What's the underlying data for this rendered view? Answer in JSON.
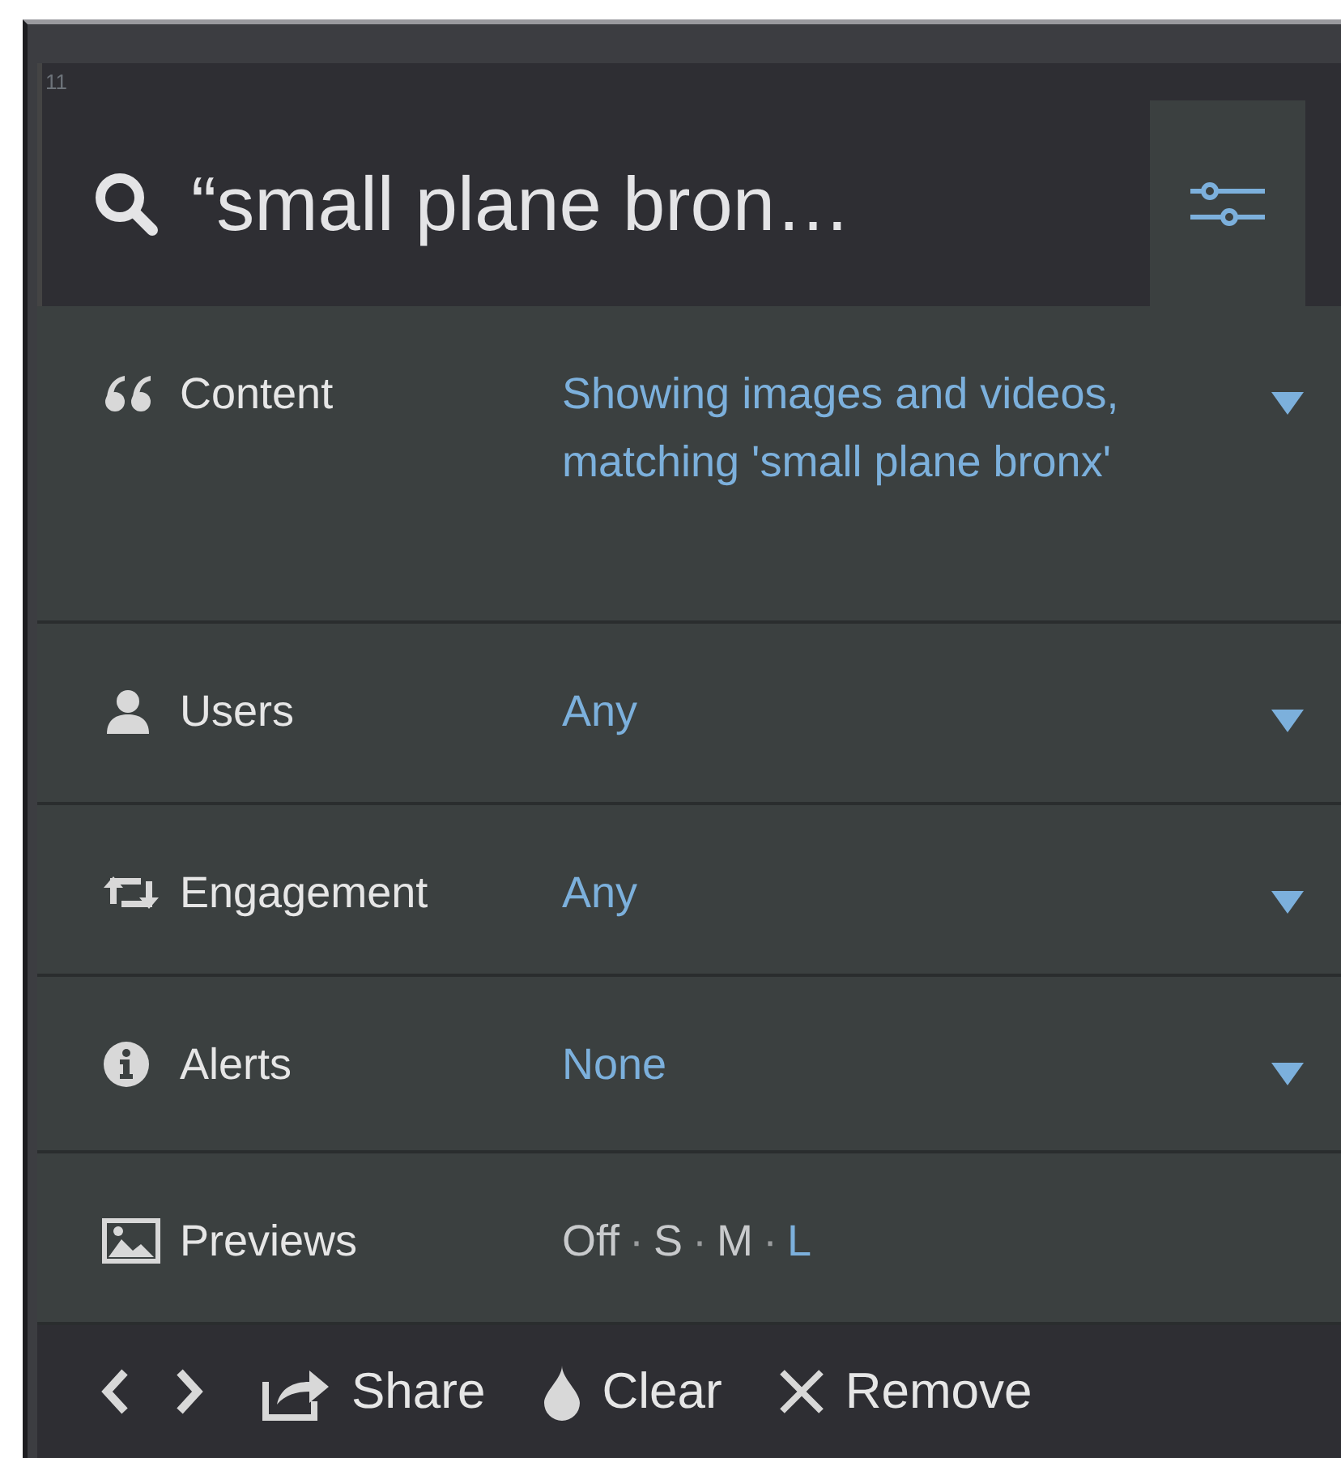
{
  "column": {
    "number": "11",
    "title": "“small plane bron…"
  },
  "filters": [
    {
      "kind": "dropdown",
      "label": "Content",
      "value": "Showing images and videos, matching 'small plane bronx'"
    },
    {
      "kind": "dropdown",
      "label": "Users",
      "value": "Any"
    },
    {
      "kind": "dropdown",
      "label": "Engagement",
      "value": "Any"
    },
    {
      "kind": "dropdown",
      "label": "Alerts",
      "value": "None"
    },
    {
      "kind": "options",
      "label": "Previews",
      "separator": "·",
      "options": [
        {
          "label": "Off",
          "selected": false
        },
        {
          "label": "S",
          "selected": false
        },
        {
          "label": "M",
          "selected": false
        },
        {
          "label": "L",
          "selected": true
        }
      ]
    }
  ],
  "footer": [
    {
      "label": "Share"
    },
    {
      "label": "Clear"
    },
    {
      "label": "Remove"
    }
  ]
}
